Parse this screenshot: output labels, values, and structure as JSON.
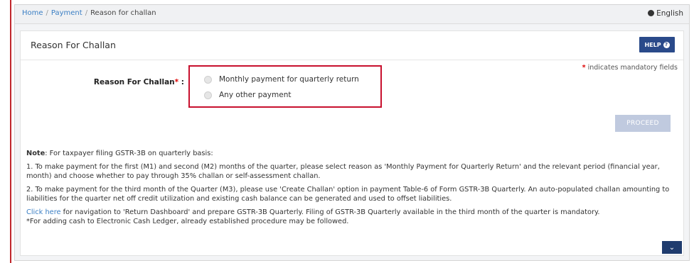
{
  "breadcrumb": {
    "home": "Home",
    "payment": "Payment",
    "current": "Reason for challan"
  },
  "language": {
    "label": "English"
  },
  "page": {
    "title": "Reason For Challan",
    "help_label": "HELP",
    "mandatory_text": "indicates mandatory fields"
  },
  "form": {
    "label": "Reason For Challan",
    "required_mark": "*",
    "colon": ":",
    "options": [
      "Monthly payment for quarterly return",
      "Any other payment"
    ],
    "proceed_label": "PROCEED"
  },
  "notes": {
    "note_bold": "Note",
    "note_intro": ": For taxpayer filing GSTR-3B on quarterly basis:",
    "point1": "1. To make payment for the first (M1) and second (M2) months of the quarter, please select reason as 'Monthly Payment for Quarterly Return' and the relevant period (financial year, month) and choose whether to pay through 35% challan or self-assessment challan.",
    "point2": "2. To make payment for the third month of the Quarter (M3), please use 'Create Challan' option in payment Table-6 of Form GSTR-3B Quarterly. An auto-populated challan amounting to liabilities for the quarter net off credit utilization and existing cash balance can be generated and used to offset liabilities.",
    "click_here": "Click here",
    "click_rest": " for navigation to 'Return Dashboard' and prepare GSTR-3B Quarterly. Filing of GSTR-3B Quarterly available in the third month of the quarter is mandatory.",
    "cash_note": "*For adding cash to Electronic Cash Ledger, already established procedure may be followed."
  },
  "colors": {
    "accent": "#2a4a8a",
    "highlight_border": "#c8102e",
    "link": "#3b7fc4"
  }
}
